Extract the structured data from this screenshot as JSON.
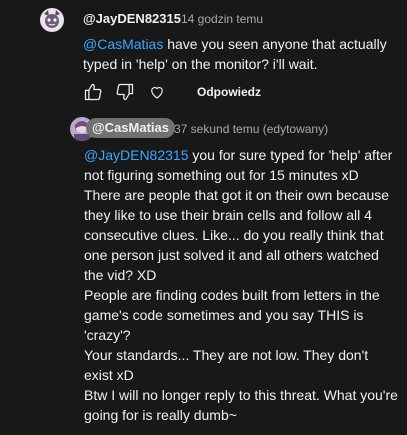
{
  "comment1": {
    "author": "@JayDEN82315",
    "timestamp": "14 godzin temu",
    "mention": "@CasMatias",
    "text": " have you seen anyone that actually typed in 'help' on the monitor? i'll wait.",
    "actions": {
      "like_icon": "thumb-up-icon",
      "dislike_icon": "thumb-down-icon",
      "heart_icon": "heart-icon",
      "reply_label": "Odpowiedz"
    }
  },
  "comment2": {
    "author": "@CasMatias",
    "timestamp": "37 sekund temu (edytowany)",
    "mention": "@JayDEN82315",
    "paragraphs": [
      " you for sure typed for 'help' after not figuring something out for  15 minutes xD",
      "There are people that got it on their own because they like to use their brain cells and follow all 4 consecutive clues. Like... do you really think that one person just solved it and all others watched the vid? XD",
      "People are finding codes built from letters in the game's code sometimes and you say THIS is 'crazy'?",
      "Your standards... They are not low. They don't exist xD",
      "Btw I will no longer reply to this threat. What you're going for is really dumb~"
    ]
  },
  "colors": {
    "background": "#181818",
    "text": "#f1f1f1",
    "secondary_text": "#aaaaaa",
    "mention": "#3ea6ff",
    "author_chip": "#717171"
  }
}
